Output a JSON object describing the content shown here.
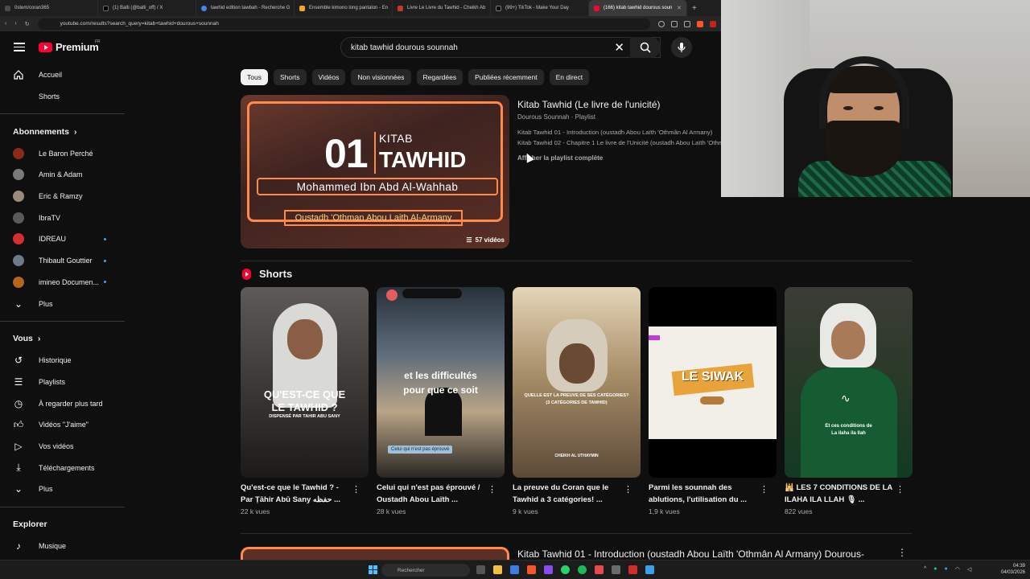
{
  "browser": {
    "tabs": [
      {
        "label": "0stem/coran365",
        "color": "#4a4a4a"
      },
      {
        "label": "(1) Balti (@balti_off) / X",
        "color": "#000000"
      },
      {
        "label": "tawhid edition tawbah - Recherche G",
        "color": "#4285f4"
      },
      {
        "label": "Ensemble kimono long pantalon - En",
        "color": "#f5a623"
      },
      {
        "label": "Livre Le Livre du Tawhid - Cheikh Ab",
        "color": "#c0392b"
      },
      {
        "label": "(99+) TikTok - Make Your Day",
        "color": "#111111"
      },
      {
        "label": "(166) kitab tawhid dourous soun",
        "color": "#ff0033",
        "active": true
      }
    ],
    "url": "youtube.com/results?search_query=kitab+tawhid+dourous+sounnah"
  },
  "header": {
    "logo_text": "Premium",
    "region": "FR",
    "search_query": "kitab tawhid dourous sounnah"
  },
  "sidebar": {
    "main": [
      {
        "label": "Accueil",
        "icon": "home-icon"
      },
      {
        "label": "Shorts",
        "icon": "shorts-icon"
      }
    ],
    "subscriptions_title": "Abonnements",
    "subscriptions": [
      {
        "label": "Le Baron Perché",
        "color": "#8a2b1a",
        "dot": false
      },
      {
        "label": "Amin & Adam",
        "color": "#7a7a7a",
        "dot": false
      },
      {
        "label": "Eric & Ramzy",
        "color": "#9a8a7a",
        "dot": false
      },
      {
        "label": "IbraTV",
        "color": "#5a5a5a",
        "dot": false
      },
      {
        "label": "IDREAU",
        "color": "#d32f2f",
        "dot": true
      },
      {
        "label": "Thibault Gouttier",
        "color": "#6d7a8a",
        "dot": true
      },
      {
        "label": "imineo Documen...",
        "color": "#b5651d",
        "dot": true
      },
      {
        "label": "Plus",
        "icon": "chevron-down-icon"
      }
    ],
    "you_title": "Vous",
    "you": [
      {
        "label": "Historique",
        "icon": "history-icon"
      },
      {
        "label": "Playlists",
        "icon": "playlists-icon"
      },
      {
        "label": "À regarder plus tard",
        "icon": "clock-icon"
      },
      {
        "label": "Vidéos \"J'aime\"",
        "icon": "thumbs-up-icon"
      },
      {
        "label": "Vos vidéos",
        "icon": "video-icon"
      },
      {
        "label": "Téléchargements",
        "icon": "download-icon"
      },
      {
        "label": "Plus",
        "icon": "chevron-down-icon"
      }
    ],
    "explore_title": "Explorer",
    "explore": [
      {
        "label": "Musique",
        "icon": "music-icon"
      }
    ]
  },
  "chips": [
    "Tous",
    "Shorts",
    "Vidéos",
    "Non visionnées",
    "Regardées",
    "Publiées récemment",
    "En direct"
  ],
  "playlist": {
    "thumb_number": "01",
    "thumb_kitab": "KITAB",
    "thumb_tawhid": "TAWHID",
    "thumb_author": "Mohammed Ibn Abd Al-Wahhab",
    "thumb_teacher": "Oustadh 'Othman Abou Laith Al-Armany",
    "video_count": "57 vidéos",
    "title": "Kitab Tawhid (Le livre de l'unicité)",
    "channel": "Dourous Sounnah · Playlist",
    "items": [
      "Kitab Tawhid 01 - Introduction (oustadh Abou Laïth 'Othmân Al Armany)",
      "Kitab Tawhid 02 - Chapitre 1 Le livre de l'Unicité (oustadh Abou Laïth 'Othmân Al Armany)"
    ],
    "view_all": "Afficher la playlist complète"
  },
  "shorts": {
    "title": "Shorts",
    "items": [
      {
        "title": "Qu'est-ce que le Tawhid ? - Par Ṭāhir Abū Sany حفظه ...",
        "views": "22 k vues",
        "overlay1": "QU'EST-CE QUE",
        "overlay2": "LE TAWHID ?",
        "overlay3": "DISPENSÉ PAR TAHIR ABU SANY"
      },
      {
        "title": "Celui qui n'est pas éprouvé / Oustadh Abou Laïth ...",
        "views": "28 k vues",
        "overlay1": "et les difficultés",
        "overlay2": "pour que ce soit",
        "overlay3": "Celui qui n'est pas éprouvé"
      },
      {
        "title": "La preuve du Coran que le Tawhid a 3 catégories! ...",
        "views": "9 k vues",
        "overlay1": "QUELLE EST LA PREUVE DE SES CATÉGORIES?",
        "overlay2": "(3 CATÉGORIES DE TAWHID)",
        "overlay3": "CHEIKH AL UTHAYMIN"
      },
      {
        "title": "Parmi les sounnah des ablutions, l'utilisation du ...",
        "views": "1,9 k vues",
        "overlay1": "LE SIWAK",
        "overlay2": "",
        "overlay3": ""
      },
      {
        "title": "🕌 LES 7 CONDITIONS DE LA ILAHA ILA LLAH 🎙 ...",
        "views": "822 vues",
        "overlay1": "Et ces conditions de",
        "overlay2": "La ilaha ila llah",
        "overlay3": ""
      }
    ]
  },
  "next_result": {
    "title": "Kitab Tawhid 01 - Introduction (oustadh Abou Laïth 'Othmân Al Armany) Dourous-"
  },
  "taskbar": {
    "search_placeholder": "Rechercher",
    "time": "04:39",
    "date": "04/03/2026"
  }
}
